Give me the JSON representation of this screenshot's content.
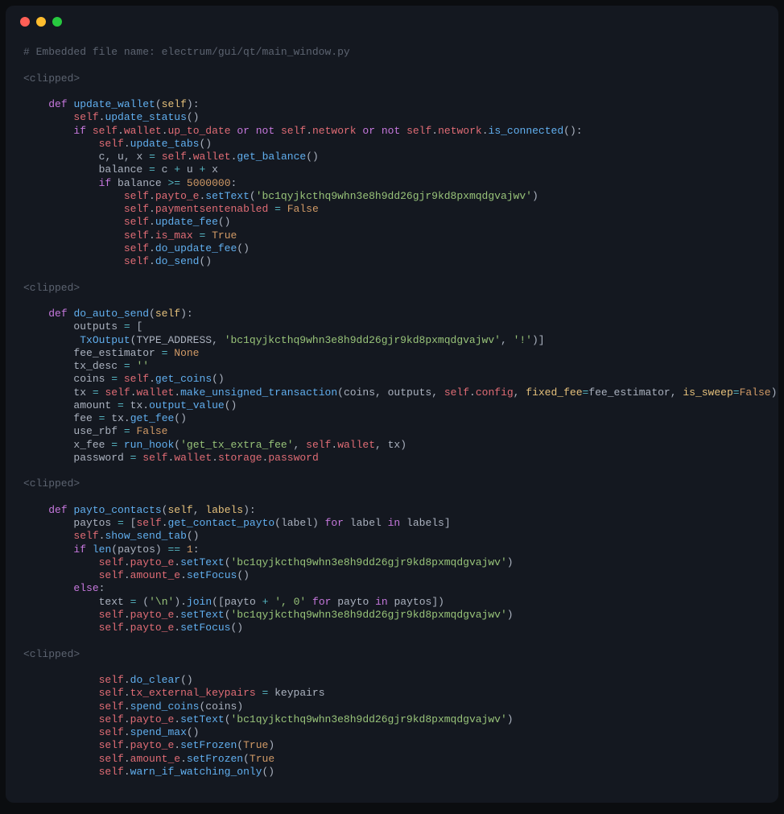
{
  "window": {
    "traffic_lights": [
      "close",
      "minimize",
      "zoom"
    ]
  },
  "code": {
    "comment_header": "# Embedded file name: electrum/gui/qt/main_window.py",
    "clipped": "<clipped>",
    "kw": {
      "def": "def",
      "if": "if",
      "or": "or",
      "not": "not",
      "for": "for",
      "in": "in",
      "else": "else"
    },
    "self": "self",
    "bool": {
      "True": "True",
      "False": "False",
      "None": "None"
    },
    "fn": {
      "update_wallet": "update_wallet",
      "update_status": "update_status",
      "is_connected": "is_connected",
      "update_tabs": "update_tabs",
      "get_balance": "get_balance",
      "setText": "setText",
      "update_fee": "update_fee",
      "do_update_fee": "do_update_fee",
      "do_send": "do_send",
      "do_auto_send": "do_auto_send",
      "TxOutput": "TxOutput",
      "get_coins": "get_coins",
      "make_unsigned_transaction": "make_unsigned_transaction",
      "output_value": "output_value",
      "get_fee": "get_fee",
      "run_hook": "run_hook",
      "payto_contacts": "payto_contacts",
      "get_contact_payto": "get_contact_payto",
      "show_send_tab": "show_send_tab",
      "len": "len",
      "setFocus": "setFocus",
      "join": "join",
      "do_clear": "do_clear",
      "spend_coins": "spend_coins",
      "spend_max": "spend_max",
      "setFrozen": "setFrozen",
      "warn_if_watching_only": "warn_if_watching_only"
    },
    "prop": {
      "wallet": "wallet",
      "up_to_date": "up_to_date",
      "network": "network",
      "payto_e": "payto_e",
      "paymentsentenabled": "paymentsentenabled",
      "is_max": "is_max",
      "config": "config",
      "storage": "storage",
      "password": "password",
      "amount_e": "amount_e",
      "tx_external_keypairs": "tx_external_keypairs"
    },
    "id": {
      "c": "c",
      "u": "u",
      "x": "x",
      "balance": "balance",
      "outputs": "outputs",
      "TYPE_ADDRESS": "TYPE_ADDRESS",
      "fee_estimator": "fee_estimator",
      "tx_desc": "tx_desc",
      "coins": "coins",
      "tx": "tx",
      "amount": "amount",
      "fee": "fee",
      "use_rbf": "use_rbf",
      "x_fee": "x_fee",
      "password_var": "password",
      "paytos": "paytos",
      "label": "label",
      "labels_p": "labels",
      "text": "text",
      "payto": "payto",
      "keypairs": "keypairs",
      "fixed_fee": "fixed_fee",
      "is_sweep": "is_sweep"
    },
    "str": {
      "addr": "'bc1qyjkcthq9whn3e8h9dd26gjr9kd8pxmqdgvajwv'",
      "bang": "'!'",
      "empty": "''",
      "get_tx_extra_fee": "'get_tx_extra_fee'",
      "nl": "'\\n'",
      "comma_zero": "', 0'"
    },
    "num": {
      "five_million": "5000000",
      "one": "1"
    }
  }
}
